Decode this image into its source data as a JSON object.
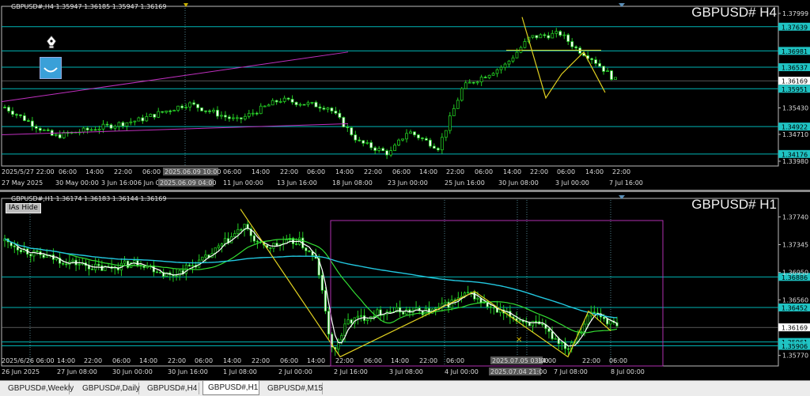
{
  "top": {
    "header": "GBPUSD#,H4  1.35947 1.36185 1.35947 1.36169",
    "title": "GBPUSD#  H4",
    "price_ticks": [
      {
        "label": "1.37999",
        "v": 1.37999
      },
      {
        "label": "1.35430",
        "v": 1.3543
      },
      {
        "label": "1.34710",
        "v": 1.3471
      },
      {
        "label": "1.33980",
        "v": 1.3398
      }
    ],
    "price_lines": [
      {
        "label": "1.37639",
        "v": 1.37639
      },
      {
        "label": "1.36981",
        "v": 1.36981
      },
      {
        "label": "1.36537",
        "v": 1.36537
      },
      {
        "label": "1.35951",
        "v": 1.35951
      },
      {
        "label": "1.34922",
        "v": 1.34922
      },
      {
        "label": "1.34176",
        "v": 1.34176
      }
    ],
    "current_price": {
      "label": "1.36169",
      "v": 1.36169
    },
    "y_range": [
      1.3385,
      1.3815
    ],
    "time_labels": [
      "2025/5/27 22:00",
      "06:00",
      "14:00",
      "22:00",
      "06:00",
      "2025.06.09 10:00",
      "06:00",
      "14:00",
      "22:00",
      "06:00",
      "14:00",
      "22:00",
      "06:00",
      "14:00",
      "22:00",
      "06:00",
      "14:00",
      "22:00",
      "06:00",
      "14:00",
      "22:00"
    ],
    "date_labels": [
      "27 May 2025",
      "30 May 00:00",
      "3 Jun 16:00",
      "6 Jun 08:00",
      "2025.06.09 04:00",
      "11 Jun 00:00",
      "13 Jun 16:00",
      "18 Jun 08:00",
      "23 Jun 00:00",
      "25 Jun 16:00",
      "30 Jun 08:00",
      "3 Jul 00:00",
      "7 Jul 16:00"
    ],
    "colors": {
      "bull": "#22cc22",
      "bear": "#22cc22",
      "price_line": "#00b5b5",
      "channel": "#c030c0",
      "zigzag": "#e0d020"
    }
  },
  "bottom": {
    "header": "GBPUSD#,H1  1.36174 1.36183 1.36144 1.36169",
    "title": "GBPUSD#  H1",
    "hide_label": "IAs Hide",
    "price_ticks": [
      {
        "label": "1.37740",
        "v": 1.3774
      },
      {
        "label": "1.37345",
        "v": 1.37345
      },
      {
        "label": "1.36950",
        "v": 1.3695
      },
      {
        "label": "1.36560",
        "v": 1.3656
      },
      {
        "label": "1.35770",
        "v": 1.3577
      }
    ],
    "price_lines": [
      {
        "label": "1.36886",
        "v": 1.36886
      },
      {
        "label": "1.36452",
        "v": 1.36452
      },
      {
        "label": "1.35961",
        "v": 1.35961
      },
      {
        "label": "1.35906",
        "v": 1.35906
      }
    ],
    "current_price": {
      "label": "1.36169",
      "v": 1.36169
    },
    "y_range": [
      1.3562,
      1.3798
    ],
    "time_labels": [
      "2025/6/26 06:00",
      "14:00",
      "22:00",
      "06:00",
      "14:00",
      "22:00",
      "06:00",
      "14:00",
      "22:00",
      "06:00",
      "14:00",
      "22:00",
      "06:00",
      "14:00",
      "22:00",
      "06:00",
      "2025.07.05 03:00",
      "14:00",
      "22:00",
      "06:00"
    ],
    "date_labels": [
      "26 Jun 2025",
      "27 Jun 08:00",
      "30 Jun 00:00",
      "30 Jun 16:00",
      "1 Jul 08:00",
      "2 Jul 00:00",
      "2 Jul 16:00",
      "3 Jul 08:00",
      "4 Jul 00:00",
      "2025.07.04 21:00",
      "7 Jul 08:00",
      "8 Jul 00:00"
    ],
    "colors": {
      "ma_fast": "#ffffff",
      "ma_mid": "#33dd33",
      "ma_slow": "#22c8e0",
      "zigzag": "#e0d020",
      "box": "#b030b0"
    }
  },
  "tabs": [
    {
      "label": "GBPUSD#,Weekly",
      "active": false
    },
    {
      "label": "GBPUSD#,Daily",
      "active": false
    },
    {
      "label": "GBPUSD#,H4",
      "active": false
    },
    {
      "label": "GBPUSD#,H1",
      "active": true
    },
    {
      "label": "GBPUSD#,M15",
      "active": false
    }
  ],
  "icons": {
    "pen": "fountain-pen-icon",
    "face": "smile-face-icon"
  }
}
